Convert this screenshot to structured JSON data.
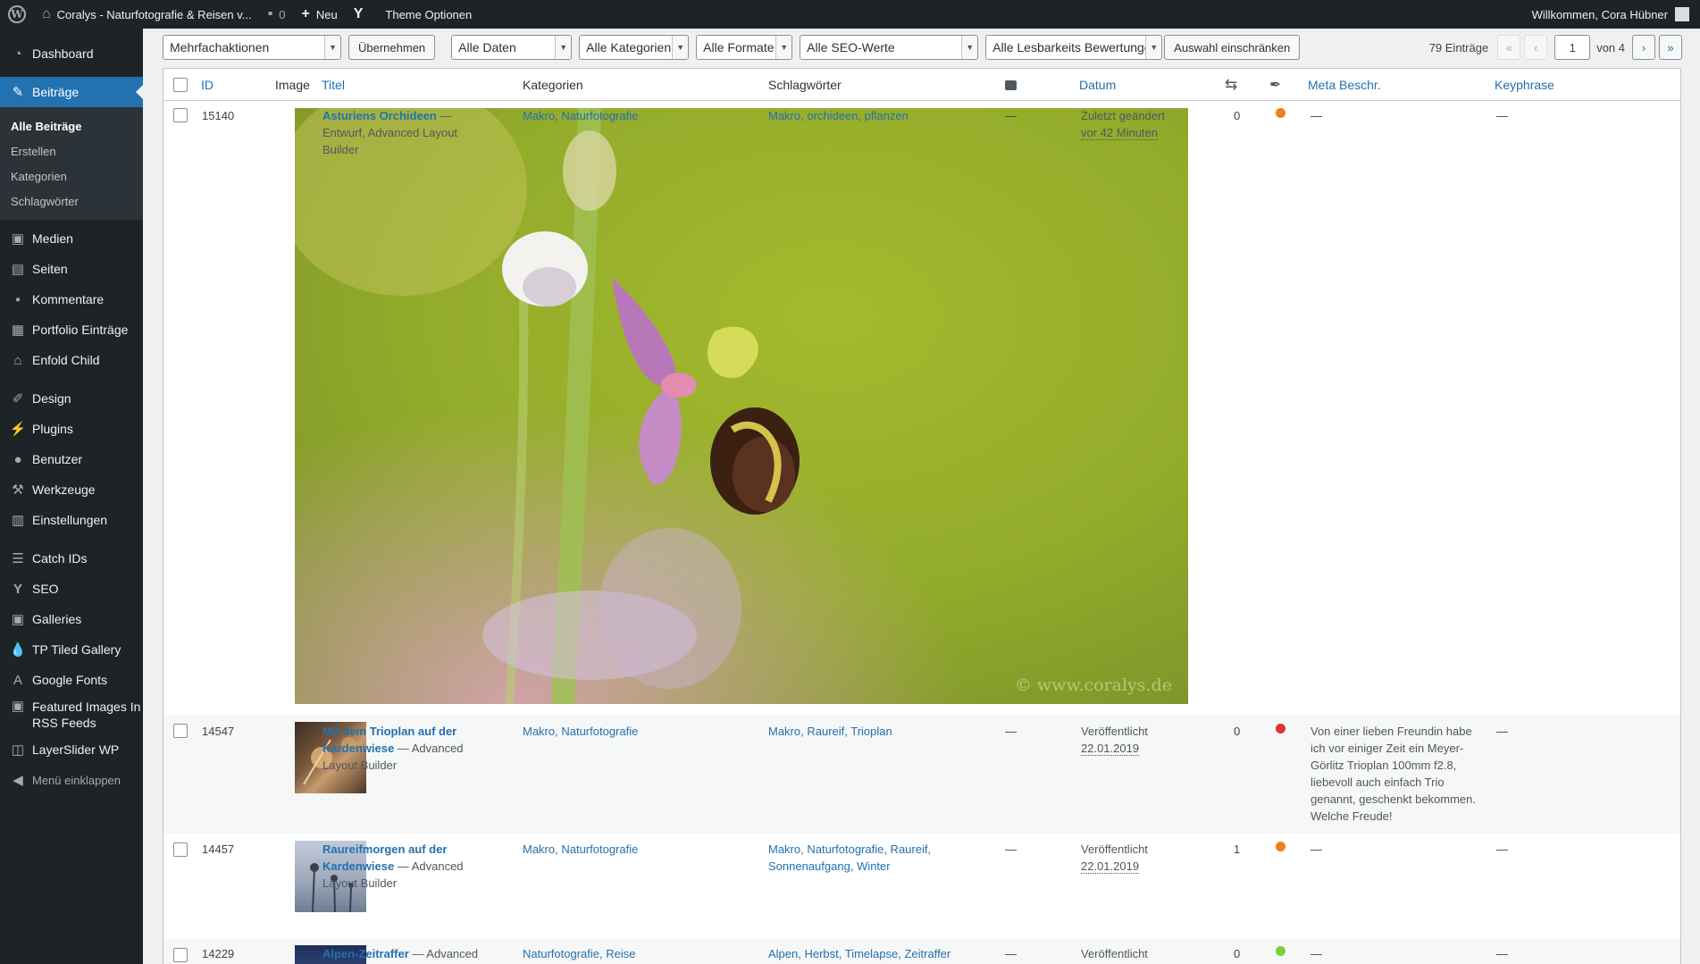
{
  "admin_bar": {
    "site_name": "Coralys - Naturfotografie & Reisen v...",
    "comments_count": "0",
    "new_label": "Neu",
    "theme_options_label": "Theme Optionen",
    "greeting": "Willkommen, Cora Hübner"
  },
  "sidebar": {
    "items_top": [
      {
        "label": "Dashboard",
        "icon": "dashboard-icon"
      }
    ],
    "current": {
      "label": "Beiträge",
      "icon": "pin-icon"
    },
    "submenu": [
      "Alle Beiträge",
      "Erstellen",
      "Kategorien",
      "Schlagwörter"
    ],
    "items_mid": [
      {
        "label": "Medien",
        "icon": "media-icon"
      },
      {
        "label": "Seiten",
        "icon": "pages-icon"
      },
      {
        "label": "Kommentare",
        "icon": "comments-icon"
      },
      {
        "label": "Portfolio Einträge",
        "icon": "portfolio-icon"
      },
      {
        "label": "Enfold Child",
        "icon": "home-icon"
      }
    ],
    "items_design": [
      {
        "label": "Design",
        "icon": "brush-icon"
      },
      {
        "label": "Plugins",
        "icon": "plugin-icon"
      },
      {
        "label": "Benutzer",
        "icon": "user-icon"
      },
      {
        "label": "Werkzeuge",
        "icon": "wrench-icon"
      },
      {
        "label": "Einstellungen",
        "icon": "settings-icon"
      }
    ],
    "items_plugins": [
      {
        "label": "Catch IDs",
        "icon": "list-icon"
      },
      {
        "label": "SEO",
        "icon": "yoast-icon"
      },
      {
        "label": "Galleries",
        "icon": "gallery-icon"
      },
      {
        "label": "TP Tiled Gallery",
        "icon": "drop-icon"
      },
      {
        "label": "Google Fonts",
        "icon": "font-icon"
      }
    ],
    "featured_rss": {
      "line1": "Featured Images In",
      "line2": "RSS Feeds"
    },
    "layerslider": "LayerSlider WP",
    "collapse": "Menü einklappen"
  },
  "toolbar": {
    "bulk_actions": "Mehrfachaktionen",
    "apply": "Übernehmen",
    "all_dates": "Alle Daten",
    "all_categories": "Alle Kategorien",
    "all_formats": "Alle Formate",
    "all_seo": "Alle SEO-Werte",
    "all_readability": "Alle Lesbarkeits Bewertungen",
    "filter": "Auswahl einschränken",
    "count": "79 Einträge",
    "first": "«",
    "prev": "‹",
    "page": "1",
    "of_pages": "von 4",
    "next": "›",
    "last": "»"
  },
  "columns": {
    "id": "ID",
    "image": "Image",
    "title": "Titel",
    "categories": "Kategorien",
    "tags": "Schlagwörter",
    "date": "Datum",
    "meta": "Meta Beschr.",
    "keyphrase": "Keyphrase"
  },
  "rows": [
    {
      "id": "15140",
      "title": "Asturiens Orchideen",
      "suffix": " — Entwurf, Advanced Layout Builder",
      "categories": "Makro, Naturfotografie",
      "tags": "Makro, orchideen, pflanzen",
      "comments": "—",
      "status": "Zuletzt geändert",
      "date": "vor 42 Minuten",
      "links": "0",
      "seo_color": "#f07f16",
      "meta": "—",
      "keyphrase": "—",
      "watermark": "© www.coralys.de"
    },
    {
      "id": "14547",
      "title": "Mit dem Trioplan auf der Kardenwiese",
      "suffix": " — Advanced Layout Builder",
      "categories": "Makro, Naturfotografie",
      "tags": "Makro, Raureif, Trioplan",
      "comments": "—",
      "status": "Veröffentlicht",
      "date": "22.01.2019",
      "links": "0",
      "seo_color": "#dc3232",
      "meta": "Von einer lieben Freundin habe ich vor einiger Zeit ein Meyer-Görlitz Trioplan 100mm f2.8, liebevoll auch einfach Trio genannt, geschenkt bekommen. Welche Freude!",
      "keyphrase": "—"
    },
    {
      "id": "14457",
      "title": "Raureifmorgen auf der Kardenwiese",
      "suffix": " — Advanced Layout Builder",
      "categories": "Makro, Naturfotografie",
      "tags": "Makro, Naturfotografie, Raureif, Sonnenaufgang, Winter",
      "comments": "—",
      "status": "Veröffentlicht",
      "date": "22.01.2019",
      "links": "1",
      "seo_color": "#f07f16",
      "meta": "—",
      "keyphrase": "—"
    },
    {
      "id": "14229",
      "title": "Alpen-Zeitraffer",
      "suffix": " — Advanced",
      "categories": "Naturfotografie, Reise",
      "tags": "Alpen, Herbst, Timelapse, Zeitraffer",
      "comments": "—",
      "status": "Veröffentlicht",
      "date": "",
      "links": "0",
      "seo_color": "#7ad03a",
      "meta": "—",
      "keyphrase": "—"
    }
  ]
}
